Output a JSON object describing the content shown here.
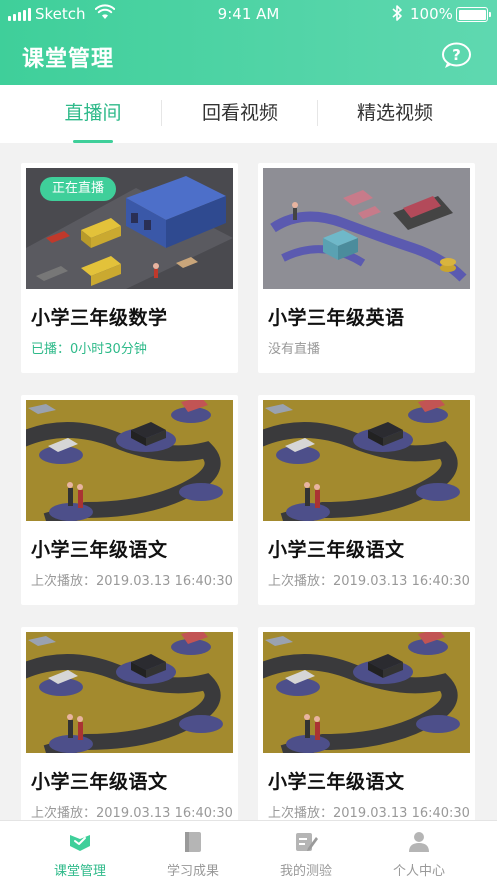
{
  "status_bar": {
    "carrier": "Sketch",
    "time": "9:41 AM",
    "battery": "100%",
    "battery_level": 1.0
  },
  "header": {
    "title": "课堂管理",
    "help_icon": "question-bubble-icon"
  },
  "tabs": [
    {
      "label": "直播间",
      "active": true
    },
    {
      "label": "回看视频",
      "active": false
    },
    {
      "label": "精选视频",
      "active": false
    }
  ],
  "cards": [
    {
      "badge": "正在直播",
      "title": "小学三年级数学",
      "subtitle": "已播：0小时30分钟",
      "illustration": "warehouse-trucks"
    },
    {
      "badge": "",
      "title": "小学三年级英语",
      "subtitle": "没有直播",
      "illustration": "online-shopping"
    },
    {
      "badge": "",
      "title": "小学三年级语文",
      "subtitle": "上次播放：2019.03.13 16:40:30",
      "illustration": "hub-logistics"
    },
    {
      "badge": "",
      "title": "小学三年级语文",
      "subtitle": "上次播放：2019.03.13 16:40:30",
      "illustration": "hub-logistics"
    },
    {
      "badge": "",
      "title": "小学三年级语文",
      "subtitle": "上次播放：2019.03.13 16:40:30",
      "illustration": "hub-logistics"
    },
    {
      "badge": "",
      "title": "小学三年级语文",
      "subtitle": "上次播放：2019.03.13 16:40:30",
      "illustration": "hub-logistics"
    }
  ],
  "bottom_nav": [
    {
      "label": "课堂管理",
      "icon": "classroom-icon",
      "active": true
    },
    {
      "label": "学习成果",
      "icon": "book-icon",
      "active": false
    },
    {
      "label": "我的测验",
      "icon": "quiz-icon",
      "active": false
    },
    {
      "label": "个人中心",
      "icon": "person-icon",
      "active": false
    }
  ],
  "colors": {
    "brand": "#3fcf9a",
    "active_text": "#2fba8a",
    "inactive_text": "#999999"
  }
}
